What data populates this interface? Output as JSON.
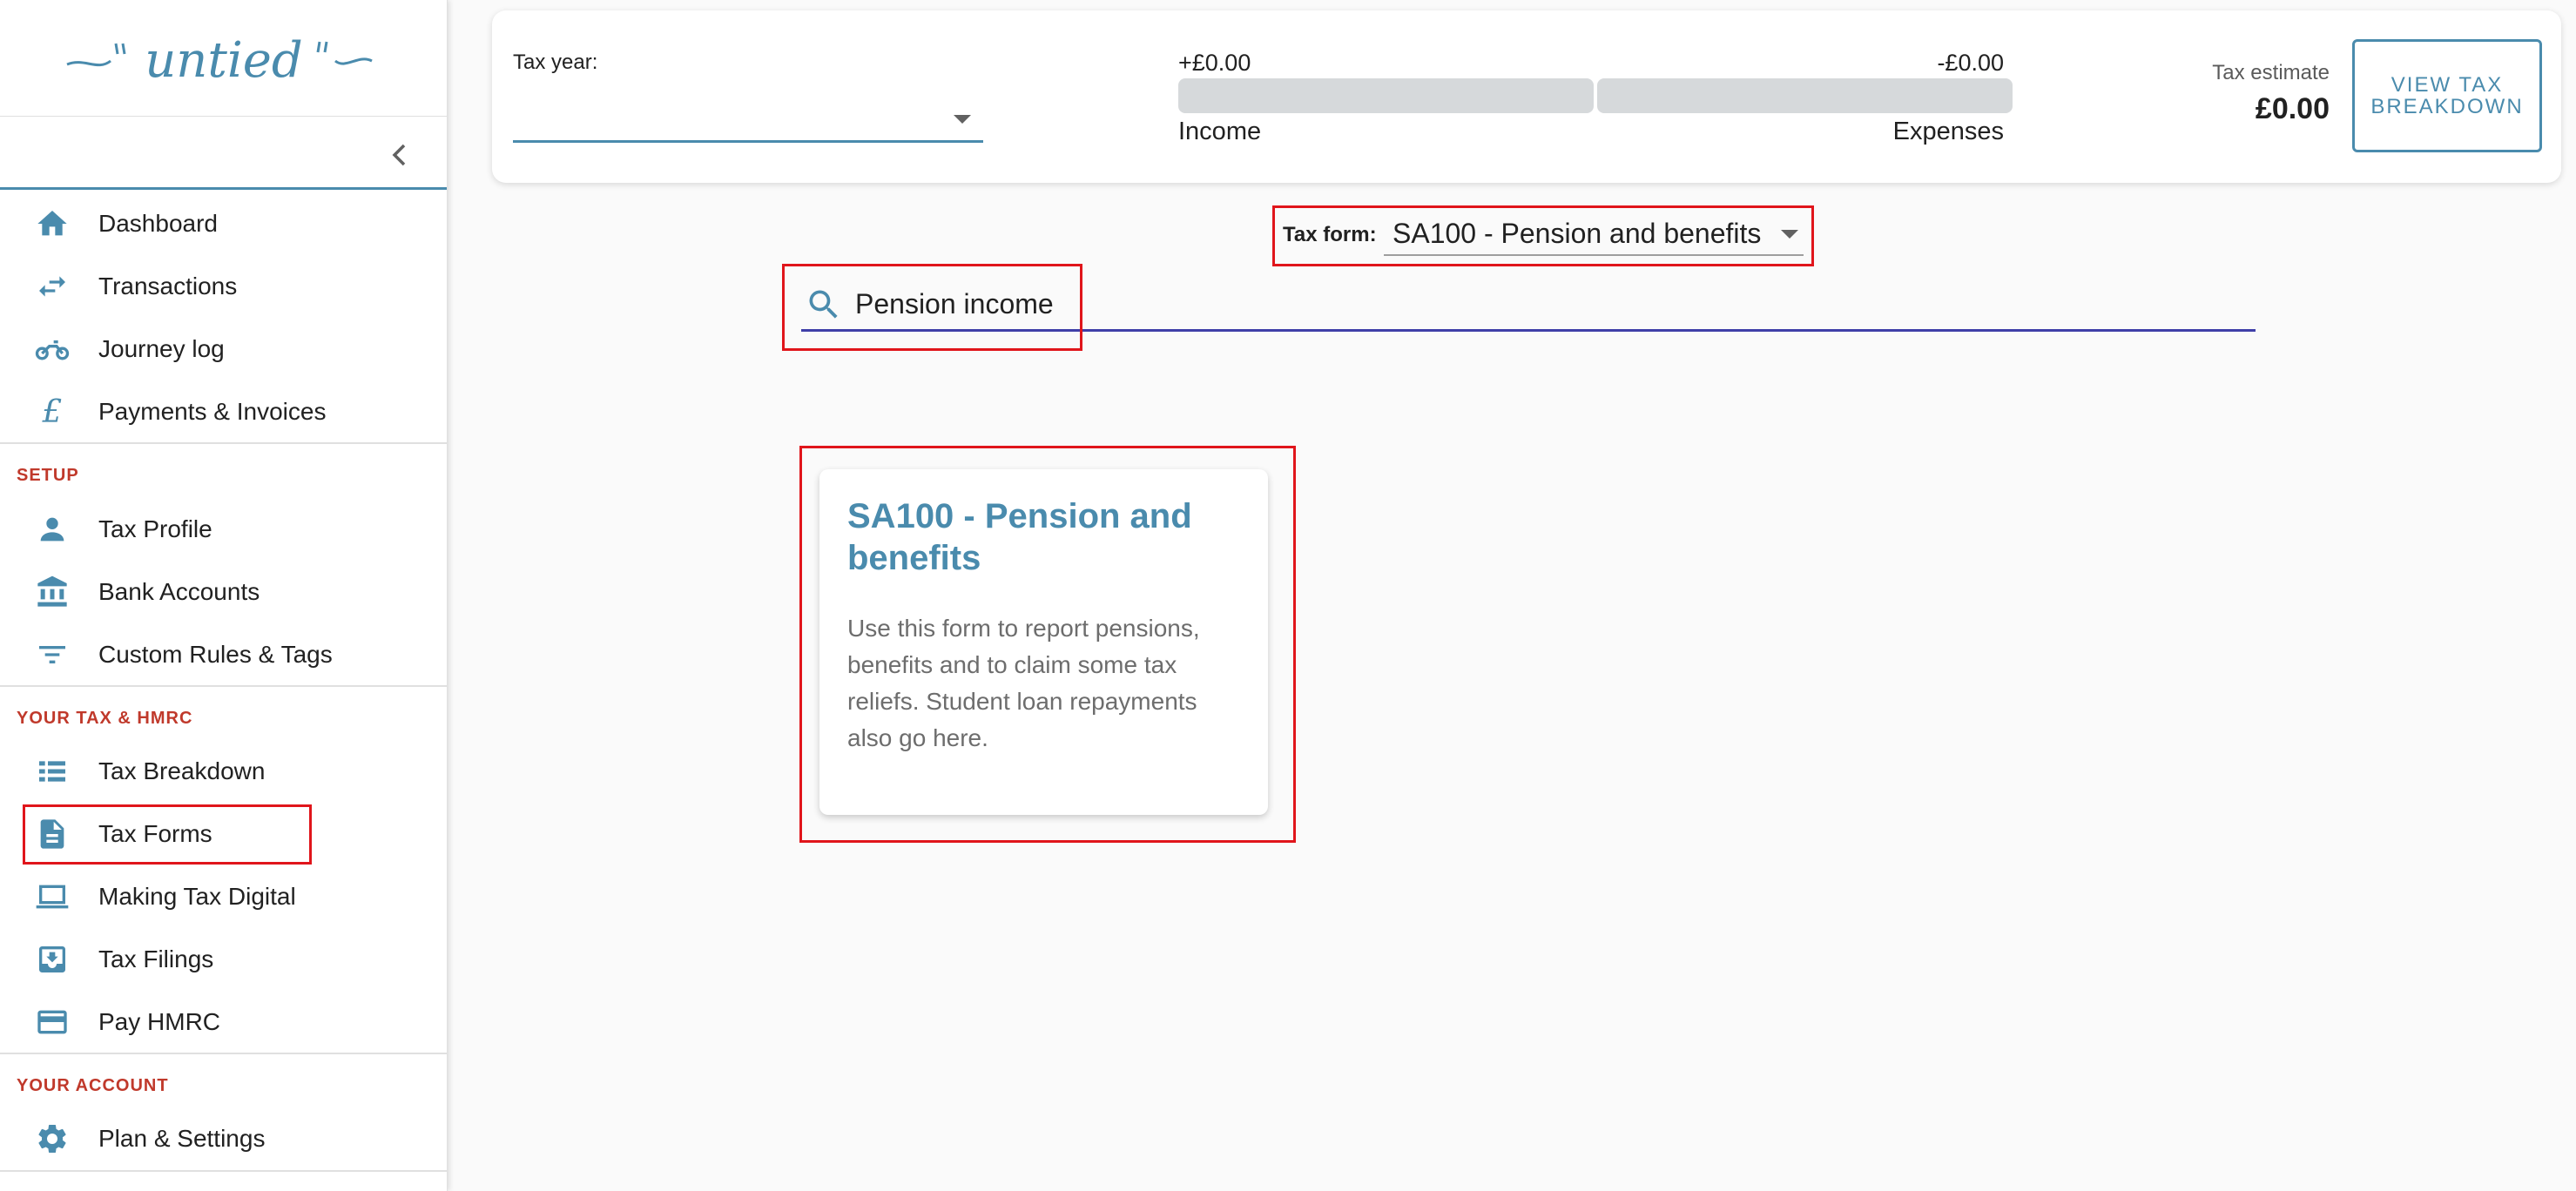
{
  "app": {
    "logo_text": "untied"
  },
  "sidebar": {
    "main_items": [
      {
        "label": "Dashboard",
        "icon": "home-icon"
      },
      {
        "label": "Transactions",
        "icon": "swap-arrows-icon"
      },
      {
        "label": "Journey log",
        "icon": "motorbike-icon"
      },
      {
        "label": "Payments & Invoices",
        "icon": "pound-icon"
      }
    ],
    "setup_label": "SETUP",
    "setup_items": [
      {
        "label": "Tax Profile",
        "icon": "person-icon"
      },
      {
        "label": "Bank Accounts",
        "icon": "bank-icon"
      },
      {
        "label": "Custom Rules & Tags",
        "icon": "filter-icon"
      }
    ],
    "tax_label": "YOUR TAX & HMRC",
    "tax_items": [
      {
        "label": "Tax Breakdown",
        "icon": "list-icon"
      },
      {
        "label": "Tax Forms",
        "icon": "document-icon",
        "active": true
      },
      {
        "label": "Making Tax Digital",
        "icon": "laptop-icon"
      },
      {
        "label": "Tax Filings",
        "icon": "inbox-download-icon"
      },
      {
        "label": "Pay HMRC",
        "icon": "credit-card-icon"
      }
    ],
    "account_label": "YOUR ACCOUNT",
    "account_items": [
      {
        "label": "Plan & Settings",
        "icon": "gear-icon"
      }
    ]
  },
  "summary": {
    "tax_year_label": "Tax year:",
    "tax_year_value": "",
    "income_value": "+£0.00",
    "expenses_value": "-£0.00",
    "income_label": "Income",
    "expenses_label": "Expenses",
    "income_fraction": 0,
    "expenses_fraction": 0,
    "estimate_label": "Tax estimate",
    "estimate_value": "£0.00",
    "view_button_label": "VIEW TAX BREAKDOWN"
  },
  "tax_form": {
    "label": "Tax form:",
    "selected": "SA100 - Pension and benefits"
  },
  "search": {
    "value": "Pension income",
    "placeholder": ""
  },
  "results": [
    {
      "title": "SA100 - Pension and benefits",
      "description": "Use this form to report pensions, benefits and to claim some tax reliefs. Student loan repayments also go here."
    }
  ],
  "colors": {
    "accent": "#4a8bad",
    "section_label": "#c0392b",
    "highlight": "#e0151b",
    "search_underline": "#3f3fa8"
  }
}
